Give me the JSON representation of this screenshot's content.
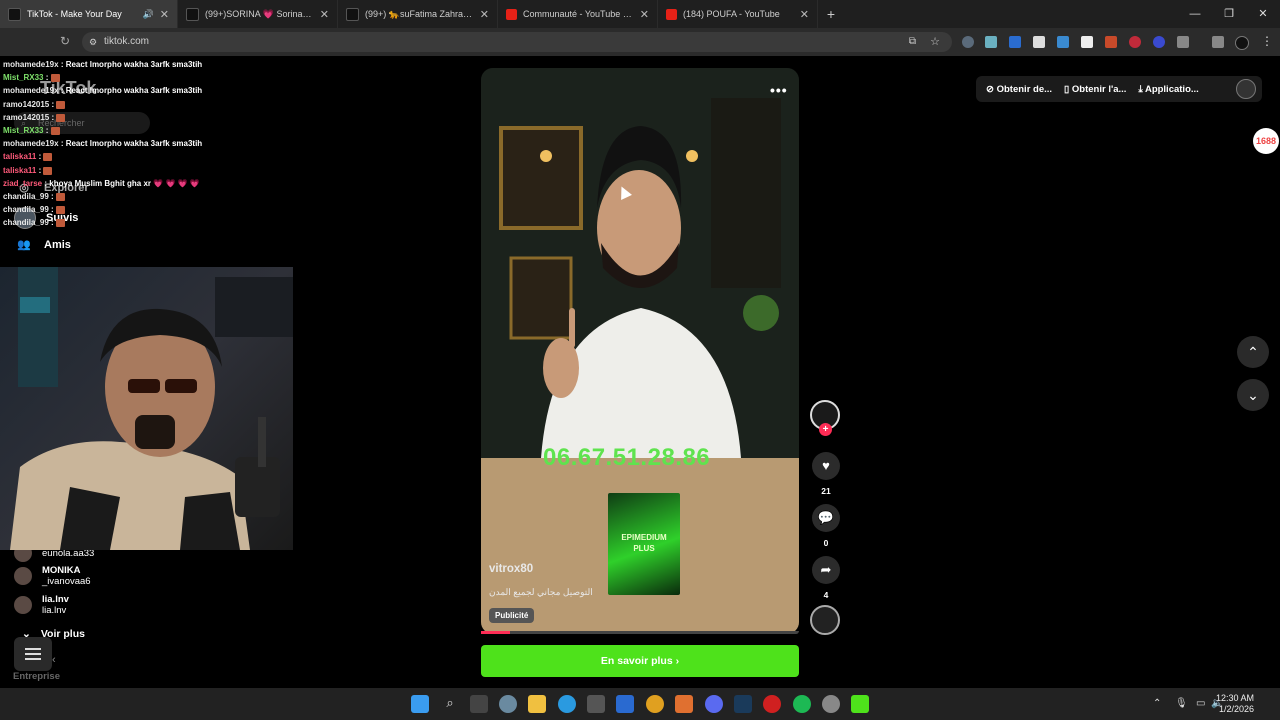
{
  "browser": {
    "tabs": [
      {
        "title": "TikTok - Make Your Day",
        "active": true
      },
      {
        "title": "(99+)SORINA 💗 Sorina 💗 (@s",
        "active": false
      },
      {
        "title": "(99+) 🐆suFatima Zahra su🐆 (",
        "active": false
      },
      {
        "title": "Communauté - YouTube Studio",
        "active": false
      },
      {
        "title": "(184) POUFA - YouTube",
        "active": false
      }
    ],
    "new_tab": "+",
    "url": "tiktok.com"
  },
  "chat": [
    {
      "user": "mohamede19x",
      "msg": "React lmorpho wakha 3arfk sma3tih",
      "color": "#e9e9e9"
    },
    {
      "user": "Mist_RX33",
      "msg": "",
      "color": "#7ee06a"
    },
    {
      "user": "mohamede19x",
      "msg": "React lmorpho wakha 3arfk sma3tih",
      "color": "#e9e9e9"
    },
    {
      "user": "ramo142015",
      "msg": "",
      "color": "#e9e9e9"
    },
    {
      "user": "ramo142015",
      "msg": "",
      "color": "#e9e9e9"
    },
    {
      "user": "Mist_RX33",
      "msg": "",
      "color": "#7ee06a"
    },
    {
      "user": "mohamede19x",
      "msg": "React lmorpho wakha 3arfk sma3tih",
      "color": "#e9e9e9"
    },
    {
      "user": "taliska11",
      "msg": "",
      "color": "#ff5a7a"
    },
    {
      "user": "taliska11",
      "msg": "",
      "color": "#ff5a7a"
    },
    {
      "user": "ziad_tarse",
      "msg": "khoya Muslim Bghit gha xr 💗 💗 💗 💗",
      "color": "#ff5a7a"
    },
    {
      "user": "chandila_99",
      "msg": "",
      "color": "#e9e9e9"
    },
    {
      "user": "chandila_99",
      "msg": "",
      "color": "#e9e9e9"
    },
    {
      "user": "chandila_99",
      "msg": "",
      "color": "#e9e9e9"
    }
  ],
  "tiktok": {
    "logo": "TikTok",
    "search_placeholder": "Rechercher",
    "nav": {
      "explorer": "Explorer",
      "suivis": "Suivis",
      "amis": "Amis"
    },
    "accounts": [
      {
        "name": "eunola.aa33",
        "handle": ""
      },
      {
        "name": "MONIKA",
        "handle": "_ivanovaa6"
      },
      {
        "name": "lia.lnv",
        "handle": "lia.lnv"
      }
    ],
    "voir_plus": "Voir plus",
    "entreprise": "Entreprise",
    "header": {
      "btn1": "Obtenir de...",
      "btn2": "Obtenir l'a...",
      "btn3": "Applicatio..."
    },
    "ali_badge": "1688"
  },
  "video": {
    "phone_overlay": "06.67.51.28.86",
    "product_brand": "EPIMEDIUM",
    "product_plus": "PLUS",
    "username": "vitrox80",
    "caption": "التوصيل مجاني لجميع المدن",
    "badge": "Publicité",
    "progress_fraction": 0.09,
    "cta": "En savoir plus"
  },
  "actions": {
    "likes": "21",
    "comments": "0",
    "shares": "4"
  },
  "taskbar": {
    "time": "12:30 AM",
    "date": "1/2/2026"
  },
  "colors": {
    "cta": "#4ee21b",
    "brand_red": "#fe2c55",
    "phone_green": "#5fe34e"
  }
}
